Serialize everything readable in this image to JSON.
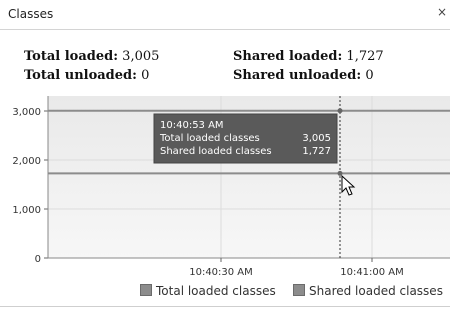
{
  "panel": {
    "title": "Classes",
    "close_glyph": "×"
  },
  "stats": {
    "total_loaded_label": "Total loaded:",
    "total_loaded_value": "3,005",
    "total_unloaded_label": "Total unloaded:",
    "total_unloaded_value": "0",
    "shared_loaded_label": "Shared loaded:",
    "shared_loaded_value": "1,727",
    "shared_unloaded_label": "Shared unloaded:",
    "shared_unloaded_value": "0"
  },
  "tooltip": {
    "time": "10:40:53 AM",
    "rows": [
      {
        "label": "Total loaded classes",
        "value": "3,005"
      },
      {
        "label": "Shared loaded classes",
        "value": "1,727"
      }
    ]
  },
  "legend": {
    "items": [
      {
        "label": "Total loaded classes",
        "color": "#8c8c8c"
      },
      {
        "label": "Shared loaded classes",
        "color": "#8c8c8c"
      }
    ]
  },
  "chart_data": {
    "type": "line",
    "y_ticks": [
      "3,000",
      "2,000",
      "1,000",
      "0"
    ],
    "y_tick_values": [
      3000,
      2000,
      1000,
      0
    ],
    "ylim": [
      0,
      3000
    ],
    "x_ticks": [
      "10:40:30 AM",
      "10:41:00 AM"
    ],
    "series": [
      {
        "name": "Total loaded classes",
        "values": [
          3005,
          3005
        ]
      },
      {
        "name": "Shared loaded classes",
        "values": [
          1727,
          1727
        ]
      }
    ],
    "hover_time": "10:40:53 AM",
    "grid": true,
    "line_color": "#8c8c8c"
  }
}
